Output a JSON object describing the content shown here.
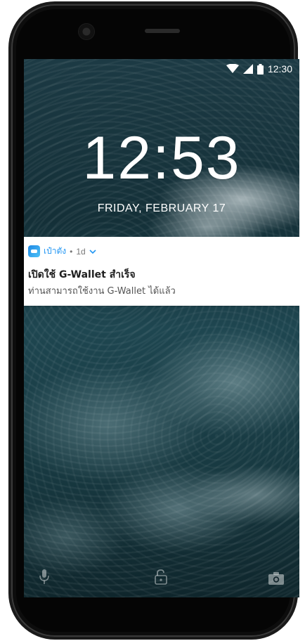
{
  "status_bar": {
    "time": "12:30",
    "icons": [
      "wifi-icon",
      "cellular-signal-icon",
      "battery-icon"
    ]
  },
  "lockscreen": {
    "clock": "12:53",
    "date": "FRIDAY, FEBRUARY 17"
  },
  "notification": {
    "app_icon": "wallet-app-icon",
    "app_name": "เป๋าตัง",
    "separator": "•",
    "time": "1d",
    "title": "เปิดใช้ G-Wallet สำเร็จ",
    "body": "ท่านสามารถใช้งาน G-Wallet ได้แล้ว",
    "accent_color": "#2196f3"
  },
  "bottom_shortcuts": {
    "icons": [
      "microphone-icon",
      "unlock-icon",
      "camera-icon"
    ]
  }
}
